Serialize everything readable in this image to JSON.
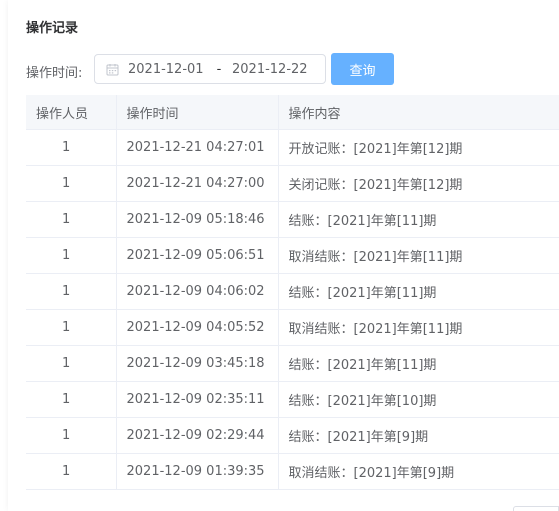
{
  "page": {
    "title": "操作记录"
  },
  "filter": {
    "label": "操作时间:",
    "start_date": "2021-12-01",
    "separator": "-",
    "end_date": "2021-12-22",
    "query_button": "查询"
  },
  "table": {
    "columns": [
      "操作人员",
      "操作时间",
      "操作内容"
    ],
    "rows": [
      {
        "user": "1",
        "time": "2021-12-21 04:27:01",
        "content": "开放记账：[2021]年第[12]期"
      },
      {
        "user": "1",
        "time": "2021-12-21 04:27:00",
        "content": "关闭记账：[2021]年第[12]期"
      },
      {
        "user": "1",
        "time": "2021-12-09 05:18:46",
        "content": "结账：[2021]年第[11]期"
      },
      {
        "user": "1",
        "time": "2021-12-09 05:06:51",
        "content": "取消结账：[2021]年第[11]期"
      },
      {
        "user": "1",
        "time": "2021-12-09 04:06:02",
        "content": "结账：[2021]年第[11]期"
      },
      {
        "user": "1",
        "time": "2021-12-09 04:05:52",
        "content": "取消结账：[2021]年第[11]期"
      },
      {
        "user": "1",
        "time": "2021-12-09 03:45:18",
        "content": "结账：[2021]年第[11]期"
      },
      {
        "user": "1",
        "time": "2021-12-09 02:35:11",
        "content": "结账：[2021]年第[10]期"
      },
      {
        "user": "1",
        "time": "2021-12-09 02:29:44",
        "content": "结账：[2021]年第[9]期"
      },
      {
        "user": "1",
        "time": "2021-12-09 01:39:35",
        "content": "取消结账：[2021]年第[9]期"
      }
    ]
  },
  "icons": {
    "date_picker": "calendar-icon"
  },
  "colors": {
    "primary_button": "#66b1ff",
    "header_bg": "#f5f7fa",
    "border": "#ebeef5"
  }
}
